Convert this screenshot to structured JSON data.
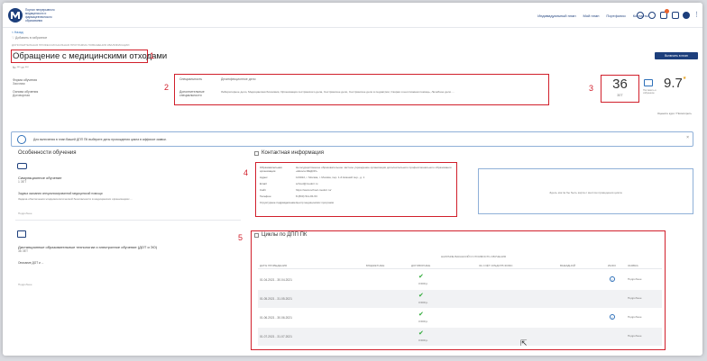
{
  "header": {
    "logo_text": "Портал непрерывного медицинского и фармацевтического образования",
    "nav": [
      "Индивидуальный план",
      "Мой план",
      "Портфолио",
      "Контакты"
    ],
    "notification_count": "3"
  },
  "back_link": "< Назад",
  "favorite": "Добавить в избранное",
  "breadcrumb": "ДОПОЛНИТЕЛЬНАЯ ПРОФЕССИОНАЛЬНАЯ ПРОГРАММА ПОВЫШЕНИЯ КВАЛИФИКАЦИИ",
  "title": "Обращение с медицинскими отходами",
  "title_marker": "1",
  "subinfo": "№ *** от ***",
  "enroll_button": "Включить в план",
  "left_meta": [
    {
      "label": "Форма обучения",
      "value": "Заочная"
    },
    {
      "label": "Основа обучения",
      "value": "Договорная"
    }
  ],
  "spec": {
    "marker": "2",
    "main_label": "Специальность",
    "main_value": "Дезинфекционное дело",
    "extra_label": "Дополнительные специальности",
    "extra_value": "Лабораторное дело, Медицинская биохимия, Организация сестринского дела, Сестринское дело, Сестринское дело в педиатрии, Скорая и неотложная помощь, Лечебное дело ..."
  },
  "hours": {
    "marker": "3",
    "value": "36",
    "unit": "ЗЕТ",
    "note": "Поставить в избранное"
  },
  "rating": {
    "value": "9.7",
    "star": "★"
  },
  "rate_link": "Оцените курс / Посмотреть",
  "alert_text": "Для включения в план Вашей ДПП ПК выберите даты прохождения цикла в аффиксе заявки.",
  "features": {
    "title": "Особенности обучения",
    "sim_label": "Симуляционное обучение",
    "sim_value": "1 ЗЕТ",
    "task_label": "Задача оказания специализированной медицинской помощи",
    "task_text": "Задача обеспечения эпидемиологической безопасности в медицинских организациях ...",
    "more": "Подробнее",
    "dot_title": "Дистанционные образовательные технологии и электронное обучение (ДОТ и ЭО)",
    "dot_value": "36 ЗЕТ",
    "dot_sub": "Описание ДОТ и ...",
    "dot_more": "Подробнее"
  },
  "contacts": {
    "title": "Контактная информация",
    "marker": "4",
    "rows": [
      {
        "label": "Образовательная организация",
        "value": "Негосударственное образовательное частное учреждение организация дополнительного профессионального образования «Школа МЕДОР»"
      },
      {
        "label": "Адрес",
        "value": "123022, г. Москва, г. Москва, пер. 1-й Нижний пер., д. 1"
      },
      {
        "label": "Email",
        "value": "school@medori.ru"
      },
      {
        "label": "Сайт",
        "value": "https://www.school-medori.ru/"
      },
      {
        "label": "Телефон",
        "value": "8 (800) 511-84-53"
      },
      {
        "label": "Структурное подразделение",
        "value": "Центр медицинских программ"
      }
    ],
    "map_placeholder": "Здесь могла бы быть карта с местом проведения цикла"
  },
  "cycles": {
    "title": "Циклы по ДПП ПК",
    "marker": "5",
    "group_header": "НАЛИЧИЕ ВАКАНСИЙ И СТОИМОСТЬ ОБУЧЕНИЯ",
    "columns": [
      "ДАТЫ ПРОВЕДЕНИЯ",
      "БЮДЖЕТНЫЕ",
      "ДОГОВОРНЫЕ",
      "ЗА СЧЁТ СРЕДСТВ ФОМС",
      "ВЫЕЗДНОЙ",
      "ИНФО",
      "ЗАЯВКА"
    ],
    "rows": [
      {
        "dates": "01.04.2021 - 30.04.2021",
        "price": "3 000 р.",
        "action": "Подробнее",
        "info": "i"
      },
      {
        "dates": "01.05.2021 - 31.05.2021",
        "price": "3 000 р.",
        "action": "Подробнее",
        "info": ""
      },
      {
        "dates": "01.06.2021 - 30.06.2021",
        "price": "3 000 р.",
        "action": "Подробнее",
        "info": "i"
      },
      {
        "dates": "01.07.2021 - 31.07.2021",
        "price": "3 000 р.",
        "action": "Подробнее",
        "info": ""
      }
    ]
  },
  "colors": {
    "accent": "#1d3f7c",
    "marker": "#d11f2b",
    "ok": "#2faa38"
  }
}
